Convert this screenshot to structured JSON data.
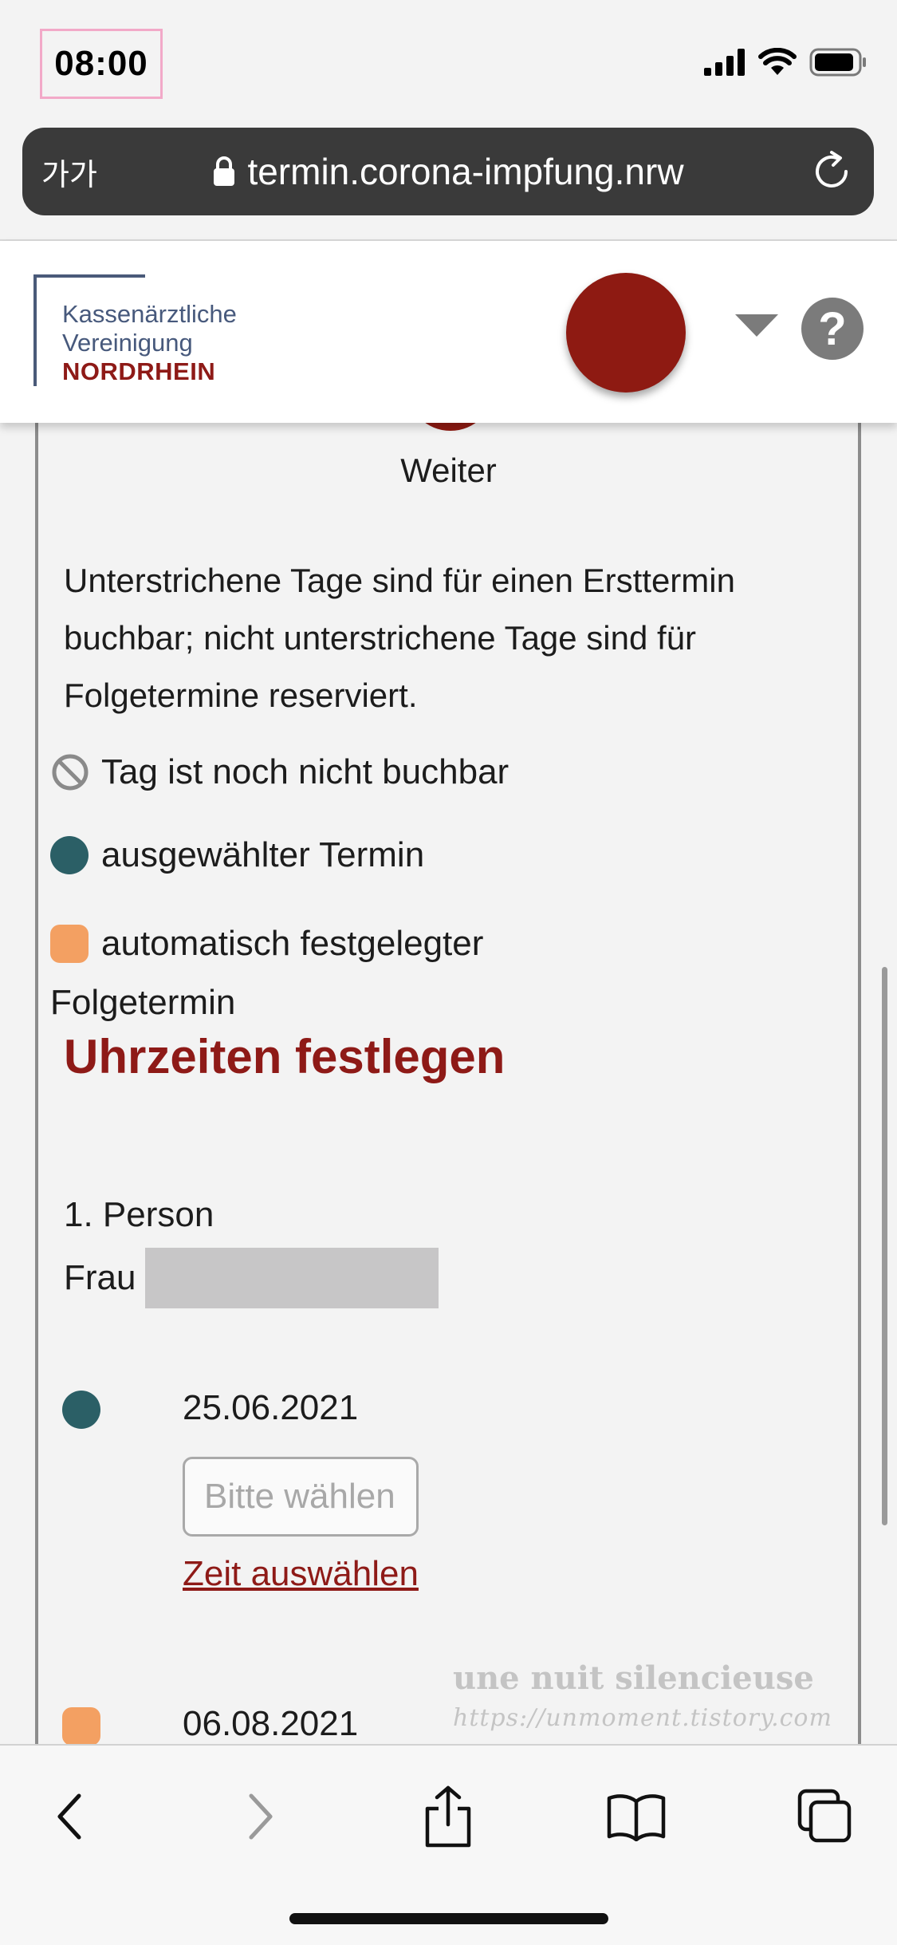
{
  "status_bar": {
    "time": "08:00",
    "icons": [
      "signal-icon",
      "wifi-icon",
      "battery-icon"
    ]
  },
  "address_bar": {
    "text_size_button": "가가",
    "url": "termin.corona-impfung.nrw",
    "icons": [
      "lock-icon",
      "reload-icon"
    ]
  },
  "site_header": {
    "logo_line1": "Kassenärztliche",
    "logo_line2": "Vereinigung",
    "logo_line3": "NORDRHEIN",
    "icons": [
      "language-dropdown-icon",
      "help-icon"
    ]
  },
  "content": {
    "next_button_label": "Weiter",
    "info_text": "Unterstrichene Tage sind für einen Ersttermin buchbar; nicht unterstrichene Tage sind für Folgetermine reserviert.",
    "legend": {
      "not_bookable": "Tag ist noch nicht buchbar",
      "selected": "ausgewählter Termin",
      "auto_line1": "automatisch festgelegter",
      "auto_line2": "Folgetermin"
    },
    "section_title": "Uhrzeiten festlegen",
    "person": {
      "index_label": "1. Person",
      "salutation": "Frau"
    },
    "appointments": [
      {
        "date": "25.06.2021",
        "time_placeholder": "Bitte wählen",
        "link_label": "Zeit auswählen",
        "color": "#2b5f66"
      },
      {
        "date": "06.08.2021",
        "color": "#f3a062"
      }
    ]
  },
  "watermark": {
    "title": "une nuit silencieuse",
    "url": "https://unmoment.tistory.com"
  },
  "toolbar": {
    "icons": [
      "back-icon",
      "forward-icon",
      "share-icon",
      "bookmarks-icon",
      "tabs-icon"
    ]
  },
  "colors": {
    "brand_red": "#8e1a17",
    "teal": "#2b5f66",
    "orange": "#f3a062"
  }
}
